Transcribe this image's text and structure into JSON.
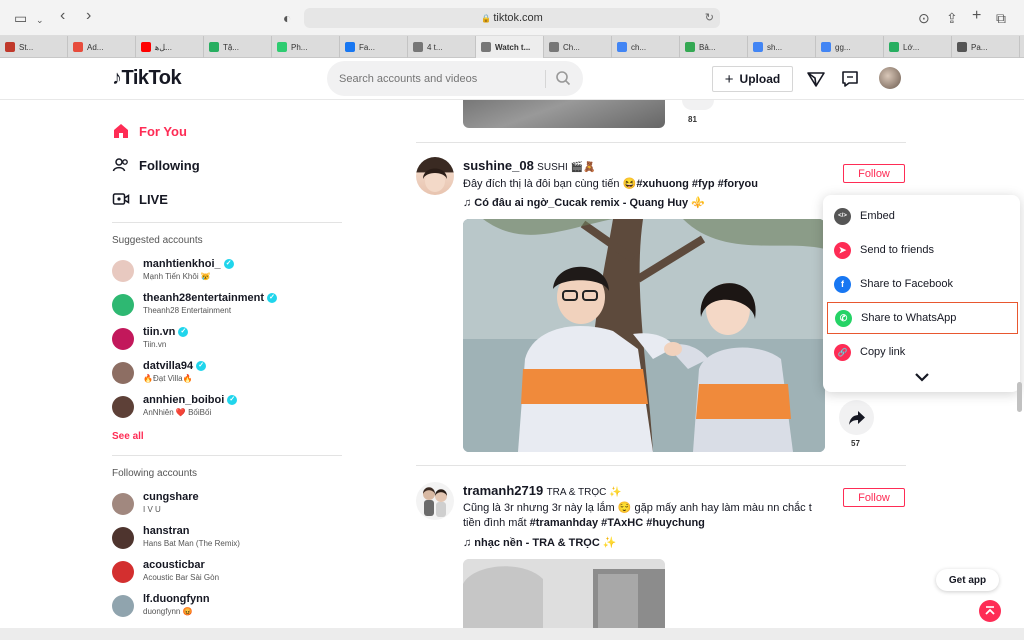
{
  "browser": {
    "url": "tiktok.com",
    "tabs": [
      {
        "label": "St...",
        "color": "#c0392b"
      },
      {
        "label": "Ad...",
        "color": "#e74c3c"
      },
      {
        "label": "ﻞﻫ...",
        "color": "#ff0000"
      },
      {
        "label": "Tậ...",
        "color": "#27ae60"
      },
      {
        "label": "Ph...",
        "color": "#2ecc71"
      },
      {
        "label": "Fa...",
        "color": "#1877f2"
      },
      {
        "label": "4 t...",
        "color": "#777777"
      },
      {
        "label": "Watch t...",
        "color": "#777777",
        "active": true
      },
      {
        "label": "Ch...",
        "color": "#777777"
      },
      {
        "label": "ch...",
        "color": "#4285f4"
      },
      {
        "label": "Bả...",
        "color": "#34a853"
      },
      {
        "label": "sh...",
        "color": "#4285f4"
      },
      {
        "label": "gg...",
        "color": "#4285f4"
      },
      {
        "label": "Lớ...",
        "color": "#27ae60"
      },
      {
        "label": "Pa...",
        "color": "#555555"
      }
    ]
  },
  "header": {
    "logo": "TikTok",
    "search_placeholder": "Search accounts and videos",
    "upload_label": "Upload"
  },
  "sidebar": {
    "nav": [
      {
        "label": "For You",
        "icon": "home-icon",
        "active": true
      },
      {
        "label": "Following",
        "icon": "following-icon",
        "active": false
      },
      {
        "label": "LIVE",
        "icon": "live-icon",
        "active": false
      }
    ],
    "suggested_title": "Suggested accounts",
    "suggested": [
      {
        "name": "manhtienkhoi_",
        "sub": "Mạnh Tiến Khôi 😿",
        "verified": true,
        "color": "#e8c9c0"
      },
      {
        "name": "theanh28entertainment",
        "sub": "Theanh28 Entertainment",
        "verified": true,
        "color": "#2eb872"
      },
      {
        "name": "tiin.vn",
        "sub": "Tiin.vn",
        "verified": true,
        "color": "#c2185b"
      },
      {
        "name": "datvilla94",
        "sub": "🔥Đạt Villa🔥",
        "verified": true,
        "color": "#8d6e63"
      },
      {
        "name": "annhien_boiboi",
        "sub": "AnNhiên ❤️ BốiBối",
        "verified": true,
        "color": "#5d4037"
      }
    ],
    "see_all": "See all",
    "following_title": "Following accounts",
    "following": [
      {
        "name": "cungshare",
        "sub": "I V U",
        "color": "#a1887f"
      },
      {
        "name": "hanstran",
        "sub": "Hans Bat Man (The Remix)",
        "color": "#4e342e"
      },
      {
        "name": "acousticbar",
        "sub": "Acoustic Bar Sài Gòn",
        "color": "#d32f2f"
      },
      {
        "name": "lf.duongfynn",
        "sub": "duongfynn 😡",
        "color": "#90a4ae"
      }
    ]
  },
  "feed": {
    "prev_count": "81",
    "posts": [
      {
        "username": "sushine_08",
        "nickname": "SUSHI 🎬🧸",
        "caption_text": "Đây đích thị là đôi bạn cùng tiến 😆",
        "tags": "#xuhuong #fyp #foryou",
        "music": "♫ Có đâu ai ngờ_Cucak remix - Quang Huy ⚜️",
        "follow": "Follow",
        "share_count": "57"
      },
      {
        "username": "tramanh2719",
        "nickname": "TRA & TRỌC ✨",
        "caption_line1": "Cũng là 3r nhưng 3r này lạ lắm 😌 gặp mấy anh hay làm màu nn chắc t",
        "caption_line2_text": "tiền đình mất ",
        "caption_line2_tags": "#tramanhday #TAxHC #huychung",
        "music": "♫ nhạc nền - TRA & TRỌC ✨",
        "follow": "Follow"
      }
    ]
  },
  "share_menu": {
    "items": [
      {
        "label": "Embed",
        "icon": "embed-icon",
        "color": "#555555"
      },
      {
        "label": "Send to friends",
        "icon": "send-icon",
        "color": "#fe2c55"
      },
      {
        "label": "Share to Facebook",
        "icon": "facebook-icon",
        "color": "#1877f2"
      },
      {
        "label": "Share to WhatsApp",
        "icon": "whatsapp-icon",
        "color": "#25d366",
        "highlight": true
      },
      {
        "label": "Copy link",
        "icon": "link-icon",
        "color": "#fe2c55"
      }
    ]
  },
  "get_app": "Get app",
  "colors": {
    "accent": "#fe2c55",
    "verified": "#20d5ec"
  }
}
